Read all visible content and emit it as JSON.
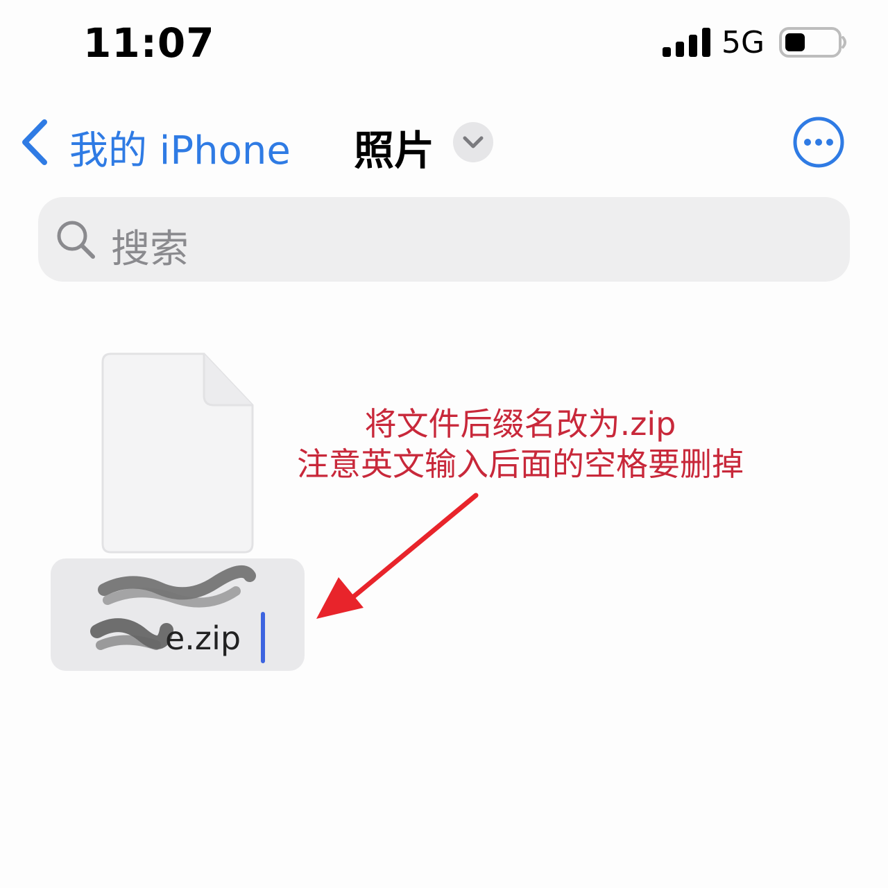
{
  "status_bar": {
    "time": "11:07",
    "network": "5G",
    "signal_icon": "cellular-signal-icon",
    "battery_icon": "battery-icon",
    "battery_level": 0.35
  },
  "nav": {
    "back_icon": "chevron-left-icon",
    "back_label": "我的 iPhone",
    "title": "照片",
    "dropdown_icon": "chevron-down-icon",
    "more_icon": "ellipsis-circle-icon",
    "accent_color": "#2f7be4"
  },
  "search": {
    "icon": "search-icon",
    "placeholder": "搜索"
  },
  "file": {
    "icon": "document-icon",
    "name_visible": "e.zip"
  },
  "annotation": {
    "line1": "将文件后缀名改为.zip",
    "line2": "注意英文输入后面的空格要删掉",
    "color": "#c8283a"
  }
}
